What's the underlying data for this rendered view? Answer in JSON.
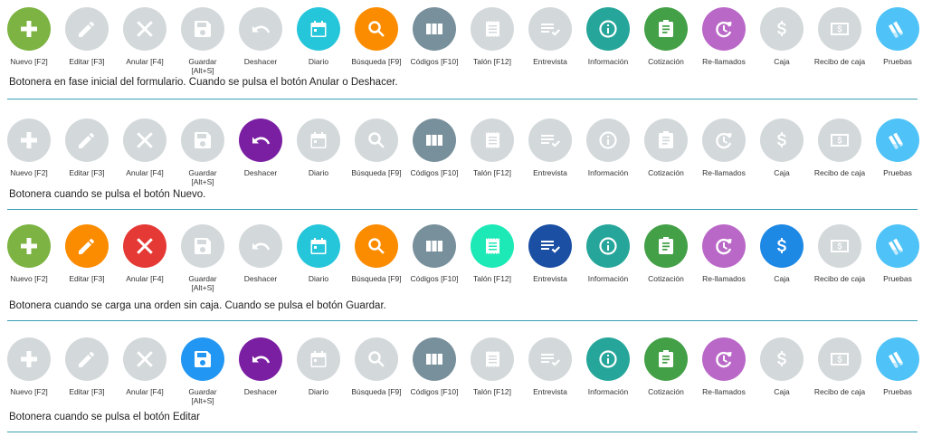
{
  "palette": {
    "disabled": "#d3d8db",
    "green": "#7cb342",
    "dark_green": "#43a047",
    "orange": "#fb8c00",
    "red": "#e53935",
    "blue": "#2196f3",
    "purple": "#7b1fa2",
    "cyan": "#26c6da",
    "slate": "#78909c",
    "teal": "#26a69a",
    "mint": "#1de9b6",
    "navy": "#1a4fa3",
    "lavender": "#ba68c8",
    "sky": "#4fc3f7",
    "caja_blue": "#1e88e5"
  },
  "buttons": [
    {
      "key": "nuevo",
      "label": "Nuevo [F2]",
      "icon": "plus-icon"
    },
    {
      "key": "editar",
      "label": "Editar [F3]",
      "icon": "pencil-icon"
    },
    {
      "key": "anular",
      "label": "Anular [F4]",
      "icon": "close-icon"
    },
    {
      "key": "guardar",
      "label": "Guardar\n[Alt+S]",
      "icon": "save-icon"
    },
    {
      "key": "deshacer",
      "label": "Deshacer",
      "icon": "undo-icon"
    },
    {
      "key": "diario",
      "label": "Diario",
      "icon": "calendar-icon"
    },
    {
      "key": "busqueda",
      "label": "Búsqueda [F9]",
      "icon": "search-icon"
    },
    {
      "key": "codigos",
      "label": "Códigos [F10]",
      "icon": "columns-icon"
    },
    {
      "key": "talon",
      "label": "Talón [F12]",
      "icon": "receipt-icon"
    },
    {
      "key": "entrevista",
      "label": "Entrevista",
      "icon": "checklist-icon"
    },
    {
      "key": "informacion",
      "label": "Información",
      "icon": "info-icon"
    },
    {
      "key": "cotizacion",
      "label": "Cotización",
      "icon": "clipboard-icon"
    },
    {
      "key": "rellamados",
      "label": "Re-llamados",
      "icon": "recall-icon"
    },
    {
      "key": "caja",
      "label": "Caja",
      "icon": "dollar-icon"
    },
    {
      "key": "recibo",
      "label": "Recibo de caja",
      "icon": "banknote-icon"
    },
    {
      "key": "pruebas",
      "label": "Pruebas",
      "icon": "tubes-icon"
    }
  ],
  "panels": [
    {
      "caption": "Botonera en fase inicial del formulario.  Cuando se pulsa el botón Anular o Deshacer.",
      "states": [
        "green",
        "disabled",
        "disabled",
        "disabled",
        "disabled",
        "cyan",
        "orange",
        "slate",
        "disabled",
        "disabled",
        "teal",
        "dark_green",
        "lavender",
        "disabled",
        "disabled",
        "sky"
      ]
    },
    {
      "caption": "Botonera cuando se pulsa el botón Nuevo.",
      "states": [
        "disabled",
        "disabled",
        "disabled",
        "disabled",
        "purple",
        "disabled",
        "disabled",
        "slate",
        "disabled",
        "disabled",
        "disabled",
        "disabled",
        "disabled",
        "disabled",
        "disabled",
        "sky"
      ]
    },
    {
      "caption": "Botonera cuando se carga una orden sin caja. Cuando se pulsa el botón Guardar.",
      "states": [
        "green",
        "orange",
        "red",
        "disabled",
        "disabled",
        "cyan",
        "orange",
        "slate",
        "mint",
        "navy",
        "teal",
        "dark_green",
        "lavender",
        "caja_blue",
        "disabled",
        "sky"
      ]
    },
    {
      "caption": "Botonera cuando se pulsa el botón Editar",
      "states": [
        "disabled",
        "disabled",
        "disabled",
        "blue",
        "purple",
        "disabled",
        "disabled",
        "slate",
        "disabled",
        "disabled",
        "teal",
        "dark_green",
        "lavender",
        "disabled",
        "disabled",
        "sky"
      ]
    }
  ]
}
